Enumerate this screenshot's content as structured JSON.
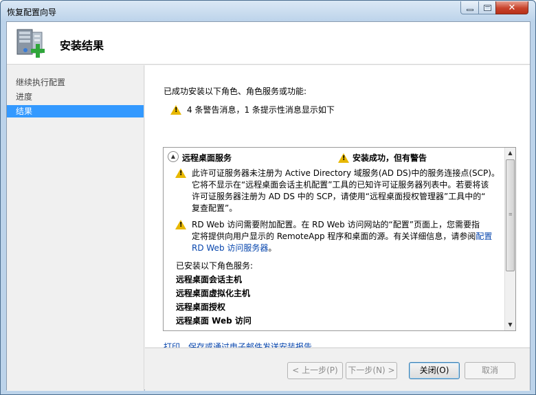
{
  "window": {
    "title": "恢复配置向导",
    "close_glyph": "✕"
  },
  "header": {
    "title": "安装结果"
  },
  "sidebar": {
    "items": [
      {
        "label": "继续执行配置"
      },
      {
        "label": "进度"
      },
      {
        "label": "结果"
      }
    ]
  },
  "main": {
    "success_label": "已成功安装以下角色、角色服务或功能:",
    "summary": "4 条警告消息，1 条提示性消息显示如下",
    "section": {
      "name": "远程桌面服务",
      "status": "安装成功，但有警告",
      "messages": [
        {
          "lines": [
            "此许可证服务器未注册为 Active Directory 域服务(AD DS)中的服务连接点(SCP)。",
            "它将不显示在“远程桌面会话主机配置”工具的已知许可证服务器列表中。若要将该",
            "许可证服务器注册为 AD DS 中的 SCP，请使用“远程桌面授权管理器”工具中的“",
            "复查配置”。"
          ]
        },
        {
          "lines": [
            "RD Web 访问需要附加配置。在 RD Web 访问网站的“配置”页面上，您需要指",
            "定将提供向用户显示的 RemoteApp 程序和桌面的源。有关详细信息，请参阅"
          ],
          "link_1": "配置",
          "link_2": "RD Web 访问服务器",
          "tail": "。"
        }
      ],
      "installed_heading": "已安装以下角色服务:",
      "services": [
        "远程桌面会话主机",
        "远程桌面虚拟化主机",
        "远程桌面授权",
        "远程桌面 Web 访问"
      ]
    },
    "print_link": "打印、保存或通过电子邮件发送安装报告"
  },
  "footer": {
    "prev": "< 上一步(P)",
    "next": "下一步(N) >",
    "close": "关闭(O)",
    "cancel": "取消"
  },
  "colors": {
    "selection": "#3399ff",
    "link": "#0645ad",
    "warning": "#e8b800"
  }
}
